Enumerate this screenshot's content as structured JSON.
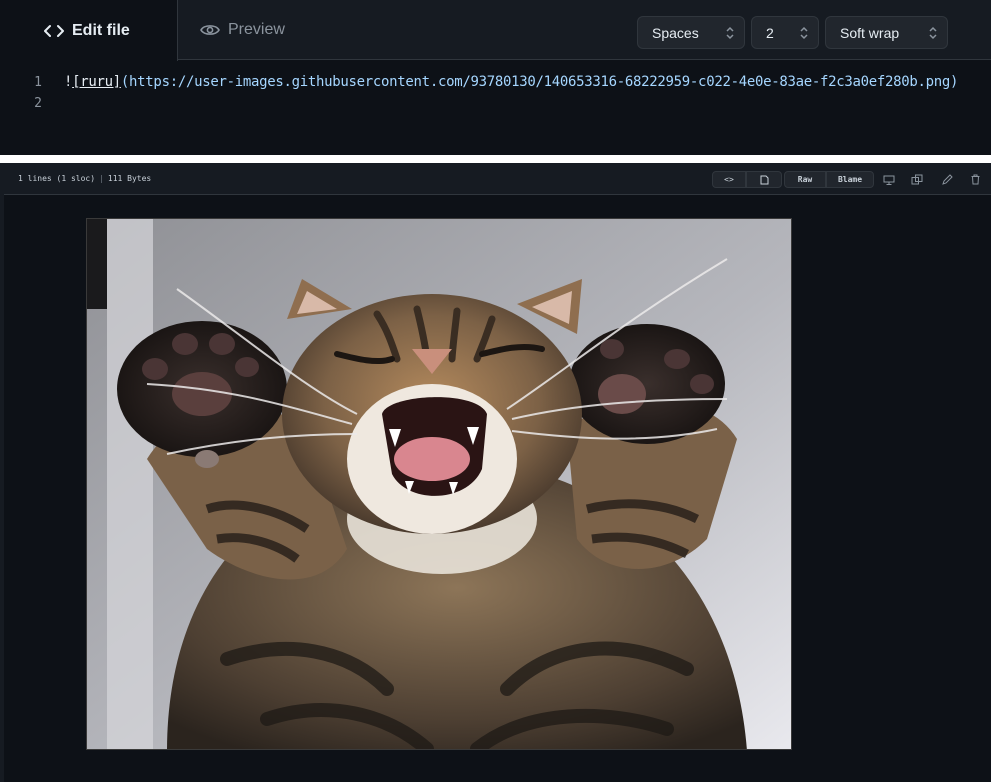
{
  "editor": {
    "tabs": {
      "edit_label": "Edit file",
      "preview_label": "Preview"
    },
    "controls": {
      "indent_mode": "Spaces",
      "indent_size": "2",
      "wrap_mode": "Soft wrap"
    },
    "lines": [
      {
        "number": "1",
        "bang": "!",
        "alt": "[ruru]",
        "url": "(https://user-images.githubusercontent.com/93780130/140653316-68222959-c022-4e0e-83ae-f2c3a0ef280b.png)"
      },
      {
        "number": "2"
      }
    ]
  },
  "viewer": {
    "meta": {
      "lines": "1 lines (1 sloc)",
      "size": "111 Bytes"
    },
    "buttons": {
      "raw": "Raw",
      "blame": "Blame",
      "code_glyph": "<>",
      "copy_icon": "copy-icon"
    },
    "icons": [
      "desktop-icon",
      "open-copy-icon",
      "pencil-icon",
      "trash-icon"
    ],
    "image_subject": "tabby cat"
  },
  "colors": {
    "background": "#0d1117",
    "header": "#161b22",
    "border": "#30363d",
    "url": "#a5d6ff",
    "muted": "#8b949e"
  }
}
